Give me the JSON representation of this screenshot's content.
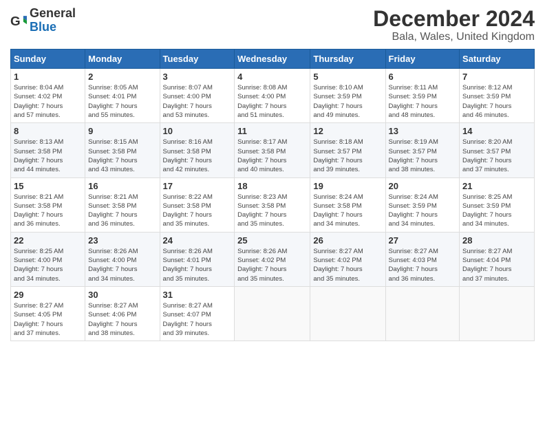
{
  "logo": {
    "general": "General",
    "blue": "Blue"
  },
  "header": {
    "title": "December 2024",
    "subtitle": "Bala, Wales, United Kingdom"
  },
  "days_of_week": [
    "Sunday",
    "Monday",
    "Tuesday",
    "Wednesday",
    "Thursday",
    "Friday",
    "Saturday"
  ],
  "weeks": [
    [
      {
        "day": "1",
        "sunrise": "Sunrise: 8:04 AM",
        "sunset": "Sunset: 4:02 PM",
        "daylight": "Daylight: 7 hours and 57 minutes."
      },
      {
        "day": "2",
        "sunrise": "Sunrise: 8:05 AM",
        "sunset": "Sunset: 4:01 PM",
        "daylight": "Daylight: 7 hours and 55 minutes."
      },
      {
        "day": "3",
        "sunrise": "Sunrise: 8:07 AM",
        "sunset": "Sunset: 4:00 PM",
        "daylight": "Daylight: 7 hours and 53 minutes."
      },
      {
        "day": "4",
        "sunrise": "Sunrise: 8:08 AM",
        "sunset": "Sunset: 4:00 PM",
        "daylight": "Daylight: 7 hours and 51 minutes."
      },
      {
        "day": "5",
        "sunrise": "Sunrise: 8:10 AM",
        "sunset": "Sunset: 3:59 PM",
        "daylight": "Daylight: 7 hours and 49 minutes."
      },
      {
        "day": "6",
        "sunrise": "Sunrise: 8:11 AM",
        "sunset": "Sunset: 3:59 PM",
        "daylight": "Daylight: 7 hours and 48 minutes."
      },
      {
        "day": "7",
        "sunrise": "Sunrise: 8:12 AM",
        "sunset": "Sunset: 3:59 PM",
        "daylight": "Daylight: 7 hours and 46 minutes."
      }
    ],
    [
      {
        "day": "8",
        "sunrise": "Sunrise: 8:13 AM",
        "sunset": "Sunset: 3:58 PM",
        "daylight": "Daylight: 7 hours and 44 minutes."
      },
      {
        "day": "9",
        "sunrise": "Sunrise: 8:15 AM",
        "sunset": "Sunset: 3:58 PM",
        "daylight": "Daylight: 7 hours and 43 minutes."
      },
      {
        "day": "10",
        "sunrise": "Sunrise: 8:16 AM",
        "sunset": "Sunset: 3:58 PM",
        "daylight": "Daylight: 7 hours and 42 minutes."
      },
      {
        "day": "11",
        "sunrise": "Sunrise: 8:17 AM",
        "sunset": "Sunset: 3:58 PM",
        "daylight": "Daylight: 7 hours and 40 minutes."
      },
      {
        "day": "12",
        "sunrise": "Sunrise: 8:18 AM",
        "sunset": "Sunset: 3:57 PM",
        "daylight": "Daylight: 7 hours and 39 minutes."
      },
      {
        "day": "13",
        "sunrise": "Sunrise: 8:19 AM",
        "sunset": "Sunset: 3:57 PM",
        "daylight": "Daylight: 7 hours and 38 minutes."
      },
      {
        "day": "14",
        "sunrise": "Sunrise: 8:20 AM",
        "sunset": "Sunset: 3:57 PM",
        "daylight": "Daylight: 7 hours and 37 minutes."
      }
    ],
    [
      {
        "day": "15",
        "sunrise": "Sunrise: 8:21 AM",
        "sunset": "Sunset: 3:58 PM",
        "daylight": "Daylight: 7 hours and 36 minutes."
      },
      {
        "day": "16",
        "sunrise": "Sunrise: 8:21 AM",
        "sunset": "Sunset: 3:58 PM",
        "daylight": "Daylight: 7 hours and 36 minutes."
      },
      {
        "day": "17",
        "sunrise": "Sunrise: 8:22 AM",
        "sunset": "Sunset: 3:58 PM",
        "daylight": "Daylight: 7 hours and 35 minutes."
      },
      {
        "day": "18",
        "sunrise": "Sunrise: 8:23 AM",
        "sunset": "Sunset: 3:58 PM",
        "daylight": "Daylight: 7 hours and 35 minutes."
      },
      {
        "day": "19",
        "sunrise": "Sunrise: 8:24 AM",
        "sunset": "Sunset: 3:58 PM",
        "daylight": "Daylight: 7 hours and 34 minutes."
      },
      {
        "day": "20",
        "sunrise": "Sunrise: 8:24 AM",
        "sunset": "Sunset: 3:59 PM",
        "daylight": "Daylight: 7 hours and 34 minutes."
      },
      {
        "day": "21",
        "sunrise": "Sunrise: 8:25 AM",
        "sunset": "Sunset: 3:59 PM",
        "daylight": "Daylight: 7 hours and 34 minutes."
      }
    ],
    [
      {
        "day": "22",
        "sunrise": "Sunrise: 8:25 AM",
        "sunset": "Sunset: 4:00 PM",
        "daylight": "Daylight: 7 hours and 34 minutes."
      },
      {
        "day": "23",
        "sunrise": "Sunrise: 8:26 AM",
        "sunset": "Sunset: 4:00 PM",
        "daylight": "Daylight: 7 hours and 34 minutes."
      },
      {
        "day": "24",
        "sunrise": "Sunrise: 8:26 AM",
        "sunset": "Sunset: 4:01 PM",
        "daylight": "Daylight: 7 hours and 35 minutes."
      },
      {
        "day": "25",
        "sunrise": "Sunrise: 8:26 AM",
        "sunset": "Sunset: 4:02 PM",
        "daylight": "Daylight: 7 hours and 35 minutes."
      },
      {
        "day": "26",
        "sunrise": "Sunrise: 8:27 AM",
        "sunset": "Sunset: 4:02 PM",
        "daylight": "Daylight: 7 hours and 35 minutes."
      },
      {
        "day": "27",
        "sunrise": "Sunrise: 8:27 AM",
        "sunset": "Sunset: 4:03 PM",
        "daylight": "Daylight: 7 hours and 36 minutes."
      },
      {
        "day": "28",
        "sunrise": "Sunrise: 8:27 AM",
        "sunset": "Sunset: 4:04 PM",
        "daylight": "Daylight: 7 hours and 37 minutes."
      }
    ],
    [
      {
        "day": "29",
        "sunrise": "Sunrise: 8:27 AM",
        "sunset": "Sunset: 4:05 PM",
        "daylight": "Daylight: 7 hours and 37 minutes."
      },
      {
        "day": "30",
        "sunrise": "Sunrise: 8:27 AM",
        "sunset": "Sunset: 4:06 PM",
        "daylight": "Daylight: 7 hours and 38 minutes."
      },
      {
        "day": "31",
        "sunrise": "Sunrise: 8:27 AM",
        "sunset": "Sunset: 4:07 PM",
        "daylight": "Daylight: 7 hours and 39 minutes."
      },
      null,
      null,
      null,
      null
    ]
  ]
}
